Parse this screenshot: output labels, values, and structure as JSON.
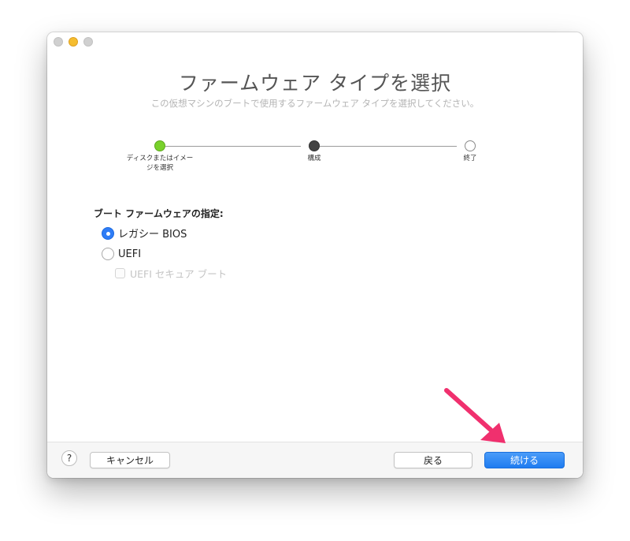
{
  "window": {
    "title": "ファームウェア タイプを選択",
    "subtitle": "この仮想マシンのブートで使用するファームウェア タイプを選択してください。"
  },
  "steps": [
    {
      "label": "ディスクまたはイメージを選択",
      "state": "completed"
    },
    {
      "label": "構成",
      "state": "current"
    },
    {
      "label": "終了",
      "state": "pending"
    }
  ],
  "firmware": {
    "label": "ブート ファームウェアの指定:",
    "options": [
      {
        "label": "レガシー BIOS",
        "selected": true
      },
      {
        "label": "UEFI",
        "selected": false
      }
    ],
    "secure_boot": {
      "label": "UEFI セキュア ブート",
      "checked": false,
      "enabled": false
    }
  },
  "footer": {
    "help": "?",
    "cancel": "キャンセル",
    "back": "戻る",
    "continue": "続ける"
  },
  "colors": {
    "accent": "#2f7df6",
    "step_complete": "#78d12b",
    "annotation_arrow": "#f0306e"
  }
}
